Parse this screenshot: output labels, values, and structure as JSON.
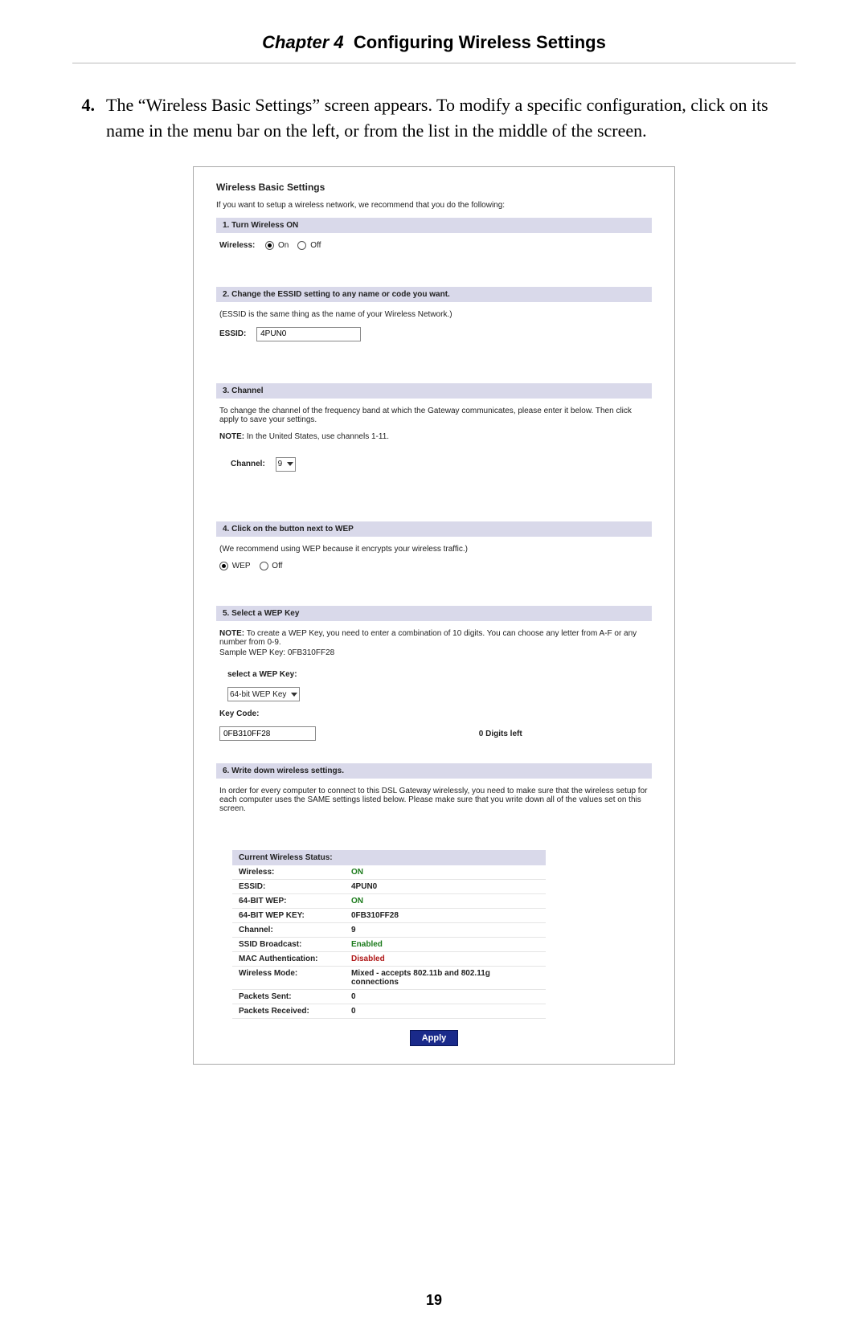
{
  "header": {
    "chapter_label": "Chapter 4",
    "chapter_title": "Configuring Wireless Settings"
  },
  "step": {
    "number": "4.",
    "text": "The “Wireless Basic Settings” screen appears. To modify a specific configuration, click on its name in the menu bar on the left, or from the list in the middle of the screen."
  },
  "screenshot": {
    "title": "Wireless Basic Settings",
    "intro": "If you want to setup a wireless network, we recommend that you do the following:",
    "section1": {
      "bar": "1. Turn Wireless ON",
      "label": "Wireless:",
      "on": "On",
      "off": "Off"
    },
    "section2": {
      "bar": "2. Change the ESSID setting to any name or code you want.",
      "desc": "(ESSID is the same thing as the name of your Wireless Network.)",
      "label": "ESSID:",
      "value": "4PUN0"
    },
    "section3": {
      "bar": "3. Channel",
      "desc": "To change the channel of the frequency band at which the Gateway communicates, please enter it below. Then click apply to save your settings.",
      "note_label": "NOTE:",
      "note_text": "In the United States, use channels 1-11.",
      "label": "Channel:",
      "value": "9"
    },
    "section4": {
      "bar": "4. Click on the button next to WEP",
      "desc": "(We recommend using WEP because it encrypts your wireless traffic.)",
      "wep": "WEP",
      "off": "Off"
    },
    "section5": {
      "bar": "5. Select a WEP Key",
      "note_label": "NOTE:",
      "note_text": "To create a WEP Key, you need to enter a combination of 10 digits. You can choose any letter from A-F or any number from 0-9.",
      "sample": "Sample WEP Key: 0FB310FF28",
      "select_label": "select a WEP Key:",
      "select_value": "64-bit WEP Key",
      "keycode_label": "Key Code:",
      "keycode_value": "0FB310FF28",
      "digits_left": "0 Digits left"
    },
    "section6": {
      "bar": "6. Write down wireless settings.",
      "desc": "In order for every computer to connect to this DSL Gateway wirelessly, you need to make sure that the wireless setup for each computer uses the SAME settings listed below. Please make sure that you write down all of the values set on this screen."
    },
    "status": {
      "head": "Current Wireless Status:",
      "rows": [
        {
          "k": "Wireless:",
          "v": "ON",
          "cls": "v-on"
        },
        {
          "k": "ESSID:",
          "v": "4PUN0",
          "cls": ""
        },
        {
          "k": "64-BIT WEP:",
          "v": "ON",
          "cls": "v-on"
        },
        {
          "k": "64-BIT WEP KEY:",
          "v": "0FB310FF28",
          "cls": ""
        },
        {
          "k": "Channel:",
          "v": "9",
          "cls": ""
        },
        {
          "k": "SSID Broadcast:",
          "v": "Enabled",
          "cls": "v-on"
        },
        {
          "k": "MAC Authentication:",
          "v": "Disabled",
          "cls": "v-disabled"
        },
        {
          "k": "Wireless Mode:",
          "v": "Mixed - accepts 802.11b and 802.11g connections",
          "cls": ""
        },
        {
          "k": "Packets Sent:",
          "v": "0",
          "cls": ""
        },
        {
          "k": "Packets Received:",
          "v": "0",
          "cls": ""
        }
      ]
    },
    "apply": "Apply"
  },
  "page_number": "19"
}
